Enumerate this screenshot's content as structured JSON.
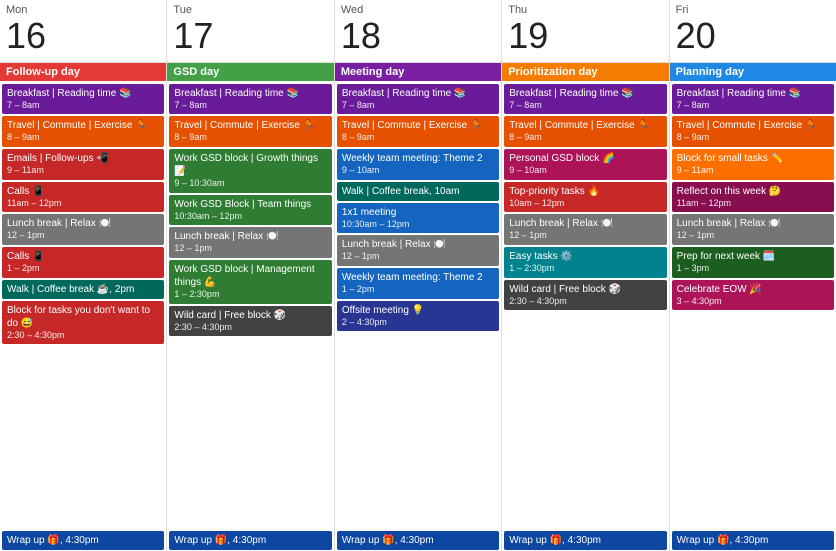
{
  "days": [
    {
      "name": "Mon",
      "num": "16",
      "label": "Follow-up day",
      "labelColor": "label-red",
      "events": [
        {
          "text": "Breakfast | Reading time 📚",
          "time": "7 – 8am",
          "color": "ev-purple"
        },
        {
          "text": "Travel | Commute | Exercise 🏃",
          "time": "8 – 9am",
          "color": "ev-orange"
        },
        {
          "text": "Emails | Follow-ups 📲",
          "time": "9 – 11am",
          "color": "ev-red"
        },
        {
          "text": "Calls 📱",
          "time": "11am – 12pm",
          "color": "ev-red"
        },
        {
          "text": "Lunch break | Relax 🍽️",
          "time": "12 – 1pm",
          "color": "ev-grey"
        },
        {
          "text": "Calls 📱",
          "time": "1 – 2pm",
          "color": "ev-red"
        },
        {
          "text": "Walk | Coffee break ☕, 2pm",
          "time": "",
          "color": "ev-teal"
        },
        {
          "text": "Block for tasks you don't want to do 😅",
          "time": "2:30 – 4:30pm",
          "color": "ev-red"
        }
      ]
    },
    {
      "name": "Tue",
      "num": "17",
      "label": "GSD day",
      "labelColor": "label-green",
      "events": [
        {
          "text": "Breakfast | Reading time 📚",
          "time": "7 – 8am",
          "color": "ev-purple"
        },
        {
          "text": "Travel | Commute | Exercise 🏃",
          "time": "8 – 9am",
          "color": "ev-orange"
        },
        {
          "text": "Work GSD block | Growth things 📝",
          "time": "9 – 10:30am",
          "color": "ev-green"
        },
        {
          "text": "Work GSD Block | Team things",
          "time": "10:30am – 12pm",
          "color": "ev-green"
        },
        {
          "text": "Lunch break | Relax 🍽️",
          "time": "12 – 1pm",
          "color": "ev-grey"
        },
        {
          "text": "Work GSD block | Management things 💪",
          "time": "1 – 2:30pm",
          "color": "ev-green"
        },
        {
          "text": "Wild card | Free block 🎲",
          "time": "2:30 – 4:30pm",
          "color": "ev-darkgrey"
        }
      ]
    },
    {
      "name": "Wed",
      "num": "18",
      "label": "Meeting day",
      "labelColor": "label-purple",
      "events": [
        {
          "text": "Breakfast | Reading time 📚",
          "time": "7 – 8am",
          "color": "ev-purple"
        },
        {
          "text": "Travel | Commute | Exercise 🏃",
          "time": "8 – 9am",
          "color": "ev-orange"
        },
        {
          "text": "Weekly team meeting: Theme 2",
          "time": "9 – 10am",
          "color": "ev-blue"
        },
        {
          "text": "Walk | Coffee break, 10am",
          "time": "",
          "color": "ev-teal"
        },
        {
          "text": "1x1 meeting",
          "time": "10:30am – 12pm",
          "color": "ev-blue"
        },
        {
          "text": "Lunch break | Relax 🍽️",
          "time": "12 – 1pm",
          "color": "ev-grey"
        },
        {
          "text": "Weekly team meeting: Theme 2",
          "time": "1 – 2pm",
          "color": "ev-blue"
        },
        {
          "text": "Offsite meeting 💡",
          "time": "2 – 4:30pm",
          "color": "ev-indigo"
        }
      ]
    },
    {
      "name": "Thu",
      "num": "19",
      "label": "Prioritization day",
      "labelColor": "label-orange",
      "events": [
        {
          "text": "Breakfast | Reading time 📚",
          "time": "7 – 8am",
          "color": "ev-purple"
        },
        {
          "text": "Travel | Commute | Exercise 🏃",
          "time": "8 – 9am",
          "color": "ev-orange"
        },
        {
          "text": "Personal GSD block 🌈",
          "time": "9 – 10am",
          "color": "ev-pink"
        },
        {
          "text": "Top-priority tasks 🔥",
          "time": "10am – 12pm",
          "color": "ev-red"
        },
        {
          "text": "Lunch break | Relax 🍽️",
          "time": "12 – 1pm",
          "color": "ev-grey"
        },
        {
          "text": "Easy tasks ⚙️",
          "time": "1 – 2:30pm",
          "color": "ev-cyan"
        },
        {
          "text": "Wild card | Free block 🎲",
          "time": "2:30 – 4:30pm",
          "color": "ev-darkgrey"
        }
      ]
    },
    {
      "name": "Fri",
      "num": "20",
      "label": "Planning day",
      "labelColor": "label-blue",
      "events": [
        {
          "text": "Breakfast | Reading time 📚",
          "time": "7 – 8am",
          "color": "ev-purple"
        },
        {
          "text": "Travel | Commute | Exercise 🏃",
          "time": "8 – 9am",
          "color": "ev-orange"
        },
        {
          "text": "Block for small tasks ✏️",
          "time": "9 – 11am",
          "color": "ev-amber"
        },
        {
          "text": "Reflect on this week 🤔",
          "time": "11am – 12pm",
          "color": "ev-magenta"
        },
        {
          "text": "Lunch break | Relax 🍽️",
          "time": "12 – 1pm",
          "color": "ev-grey"
        },
        {
          "text": "Prep for next week 🗓️",
          "time": "1 – 3pm",
          "color": "ev-darkgreen"
        },
        {
          "text": "Celebrate EOW 🎉",
          "time": "3 – 4:30pm",
          "color": "ev-pink"
        }
      ]
    }
  ],
  "wrapUp": "Wrap up 🎁, 4:30pm"
}
